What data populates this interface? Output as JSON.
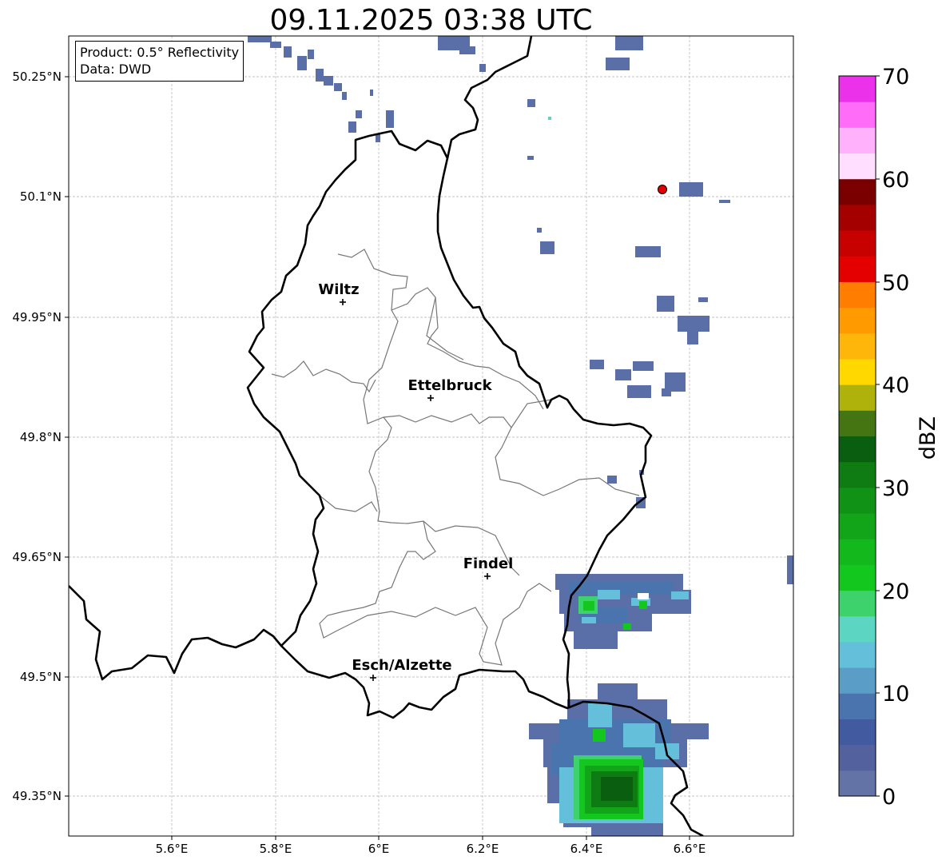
{
  "title": "09.11.2025 03:38 UTC",
  "infobox": {
    "product": "Product: 0.5° Reflectivity",
    "data": "Data: DWD"
  },
  "axes": {
    "lon_ticks": [
      "5.6°E",
      "5.8°E",
      "6°E",
      "6.2°E",
      "6.4°E",
      "6.6°E"
    ],
    "lat_ticks": [
      "50.25°N",
      "50.1°N",
      "49.95°N",
      "49.8°N",
      "49.65°N",
      "49.5°N",
      "49.35°N"
    ]
  },
  "cities": [
    {
      "name": "Wiltz"
    },
    {
      "name": "Ettelbruck"
    },
    {
      "name": "Findel"
    },
    {
      "name": "Esch/Alzette"
    }
  ],
  "colorbar": {
    "label": "dBZ",
    "ticks": [
      "0",
      "10",
      "20",
      "30",
      "40",
      "50",
      "60",
      "70"
    ],
    "colors": [
      "#6473a6",
      "#53629f",
      "#425ba0",
      "#4a74ae",
      "#5a9dc6",
      "#63bfda",
      "#5cd6c2",
      "#3dd26c",
      "#14c71e",
      "#13b81c",
      "#12a519",
      "#109217",
      "#0e7b13",
      "#0a5e0f",
      "#457512",
      "#aeb20b",
      "#ffd800",
      "#ffb60a",
      "#ff9b00",
      "#ff7d00",
      "#e50000",
      "#c70000",
      "#a50000",
      "#7a0000",
      "#ffdeff",
      "#ffb1fb",
      "#ff6cf7",
      "#eb32ea"
    ]
  },
  "radar_marker": {
    "color": "#e00000"
  }
}
